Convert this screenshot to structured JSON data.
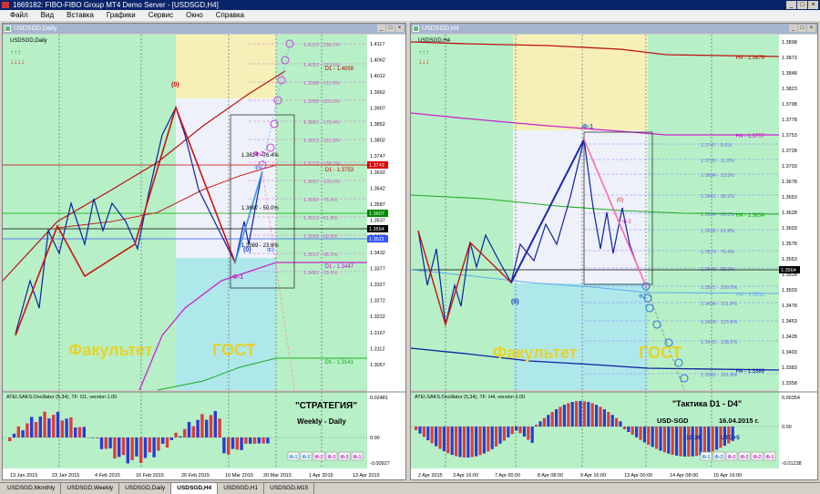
{
  "app_title": "1669182: FIBO-FIBO Group MT4 Demo Server - [USDSGD,H4]",
  "menu": [
    "Файл",
    "Вид",
    "Вставка",
    "Графики",
    "Сервис",
    "Окно",
    "Справка"
  ],
  "tabs": [
    "USDSGD,Monthly",
    "USDSGD,Weekly",
    "USDSGD,Daily",
    "USDSGD,H4",
    "USDSGD,H1",
    "USDSGD,M15"
  ],
  "active_tab": 3,
  "left": {
    "window_title": "USDSGD,Daily",
    "symbol_label": "USDSGD,Daily",
    "price_ticks": [
      "1.4117",
      "1.4062",
      "1.4012",
      "1.3962",
      "1.3907",
      "1.3852",
      "1.3802",
      "1.3747",
      "1.3692",
      "1.3642",
      "1.3587",
      "1.3537",
      "1.3487",
      "1.3432",
      "1.3377",
      "1.3327",
      "1.3272",
      "1.3222",
      "1.3167",
      "1.3112",
      "1.3057"
    ],
    "date_ticks": [
      "13 Jan 2015",
      "23 Jan 2015",
      "4 Feb 2015",
      "16 Feb 2015",
      "26 Feb 2015",
      "10 Mar 2015",
      "20 Mar 2015",
      "1 Apr 2015",
      "13 Apr 2015"
    ],
    "level_tags": [
      {
        "text": "1.3743",
        "color": "#dd0000"
      },
      {
        "text": "1.3607",
        "color": "#008800"
      },
      {
        "text": "1.3564",
        "color": "#000000"
      },
      {
        "text": "1.3521",
        "color": "#3355ff"
      }
    ],
    "fib_labels": [
      "1.4123 - 238.2%",
      "1.4053 - 223.6%",
      "1.3998 - 211.8%",
      "1.3958 - 200.0%",
      "1.3881 - 176.4%",
      "1.3823 - 161.8%",
      "1.3773 - 138.2%",
      "1.3697 - 100.0%",
      "1.3640 - 76.4%",
      "1.3613 - 61.8%",
      "1.3569 - 50.0%",
      "1.3512 - 38.2%",
      "1.3481 - 23.6%"
    ],
    "line_labels": [
      {
        "text": "D1 - 1.4059",
        "color": "#aa0000"
      },
      {
        "text": "D1 - 1.3753",
        "color": "#cc0000"
      },
      {
        "text": "D1 - 1.3447",
        "color": "#cc00cc"
      },
      {
        "text": "D1 - 1.3141",
        "color": "#00aa00"
      }
    ],
    "fibo_texts": [
      "1.3824 - 76.4%",
      "1.3697 - 50.0%",
      "1.3569 - 23.6%"
    ],
    "wave_labels": {
      "w0_top": "(0)",
      "w0_bottom": "(0)",
      "phi_minus2": "Ф-2",
      "phi_minus1_top": "Ф-1",
      "phi_minus1_bottom": "Ф-1",
      "phi2": "Ф2"
    },
    "watermark_left": "Факультет",
    "watermark_right": "ГОСТ",
    "indicator_label": "ATEI.SAKS.Oscillator (5,34), TF: D1, version 1.00",
    "ind_ticks": [
      "0.02481",
      "0.00",
      "-0.00927"
    ],
    "caption_title": "\"СТРАТЕГИЯ\"",
    "caption_sub": "Weekly - Daily",
    "legend_buttons": [
      "Ф-1",
      "Ф-2",
      "Ф-2",
      "Ф-2",
      "Ф-3",
      "Ф-1"
    ]
  },
  "right": {
    "window_title": "USDSGD,H4",
    "symbol_label": "USDSGD,H4",
    "price_ticks": [
      "1.3898",
      "1.3873",
      "1.3848",
      "1.3823",
      "1.3798",
      "1.3778",
      "1.3753",
      "1.3728",
      "1.3703",
      "1.3678",
      "1.3653",
      "1.3628",
      "1.3603",
      "1.3578",
      "1.3553",
      "1.3528",
      "1.3503",
      "1.3478",
      "1.3453",
      "1.3428",
      "1.3403",
      "1.3383",
      "1.3358"
    ],
    "date_ticks": [
      "2 Apr 2015",
      "3 Apr 16:00",
      "7 Apr 00:00",
      "8 Apr 08:00",
      "9 Apr 16:00",
      "13 Apr 00:00",
      "14 Apr 08:00",
      "15 Apr 16:00"
    ],
    "level_tags": [
      {
        "text": "1.3564",
        "color": "#000000"
      }
    ],
    "fib_labels": [
      "1.3747 - 0.0%",
      "1.3720 - 11.8%",
      "1.3694 - 23.6%",
      "1.3661 - 38.2%",
      "1.3634 - 50.0%",
      "1.3606 - 61.8%",
      "1.3574 - 76.4%",
      "1.3548 - 88.2%",
      "1.3521 - 100.0%",
      "1.3494 - 113.8%",
      "1.3468 - 123.6%",
      "1.3415 - 138.2%",
      "1.3361 - 161.8%"
    ],
    "line_labels": [
      {
        "text": "H4 - 1.3879",
        "color": "#cc0000"
      },
      {
        "text": "H4 - 1.3757",
        "color": "#cc00cc"
      },
      {
        "text": "H4 - 1.3634",
        "color": "#00aa00"
      },
      {
        "text": "H4 - 1.3511",
        "color": "#66aaee"
      },
      {
        "text": "H4 - 1.3389",
        "color": "#0000aa"
      }
    ],
    "wave_labels": {
      "phi_minus1": "Ф-1",
      "w0": "(0)",
      "w0_top": "(0)",
      "phi_minus2": "Ф-2",
      "phi2": "Ф2"
    },
    "watermark_left": "Факультет",
    "watermark_right": "ГОСТ",
    "indicator_label": "ATEI.SAKS.Oscillator (5,34), TF: H4, version 1.00",
    "ind_ticks": [
      "0.00354",
      "0.00",
      "-0.01238"
    ],
    "caption_title": "\"Тактика   D1 - D4\"",
    "caption_pair": "USD-SGD",
    "caption_date": "16.04.2015 г.",
    "caption_time": "10:20",
    "caption_tz": "UTC+5",
    "legend_buttons": [
      "Ф-1",
      "Ф-2",
      "Ф-2",
      "Ф-2",
      "Ф-2",
      "Ф-1"
    ]
  },
  "chart_data": [
    {
      "type": "line",
      "title": "USDSGD,Daily",
      "ylim": [
        1.3057,
        1.4117
      ],
      "x": [
        "13 Jan 2015",
        "23 Jan 2015",
        "4 Feb 2015",
        "16 Feb 2015",
        "26 Feb 2015",
        "10 Mar 2015",
        "20 Mar 2015",
        "1 Apr 2015",
        "13 Apr 2015"
      ]
    },
    {
      "type": "line",
      "title": "USDSGD,H4",
      "ylim": [
        1.3358,
        1.3898
      ],
      "x": [
        "2 Apr 2015",
        "3 Apr 16:00",
        "7 Apr 00:00",
        "8 Apr 08:00",
        "9 Apr 16:00",
        "13 Apr 00:00",
        "14 Apr 08:00",
        "15 Apr 16:00"
      ]
    }
  ]
}
